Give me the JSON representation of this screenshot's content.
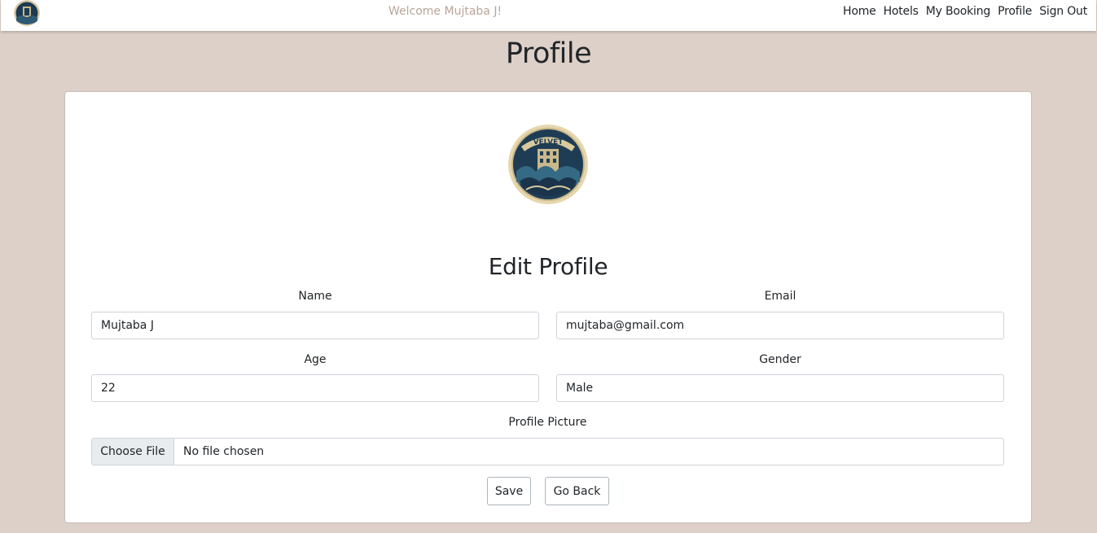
{
  "navbar": {
    "welcome": "Welcome Mujtaba J!",
    "links": [
      "Home",
      "Hotels",
      "My Booking",
      "Profile",
      "Sign Out"
    ]
  },
  "page": {
    "title": "Profile"
  },
  "form": {
    "title": "Edit Profile",
    "name": {
      "label": "Name",
      "value": "Mujtaba J"
    },
    "email": {
      "label": "Email",
      "value": "mujtaba@gmail.com"
    },
    "age": {
      "label": "Age",
      "value": "22"
    },
    "gender": {
      "label": "Gender",
      "value": "Male"
    },
    "picture": {
      "label": "Profile Picture",
      "button": "Choose File",
      "status": "No file chosen"
    },
    "save": "Save",
    "back": "Go Back"
  },
  "logo": {
    "text": "VELVET",
    "icon": "velvet-hotel-logo"
  },
  "colors": {
    "background": "#ddd0c8",
    "welcome": "#b9a59a"
  }
}
